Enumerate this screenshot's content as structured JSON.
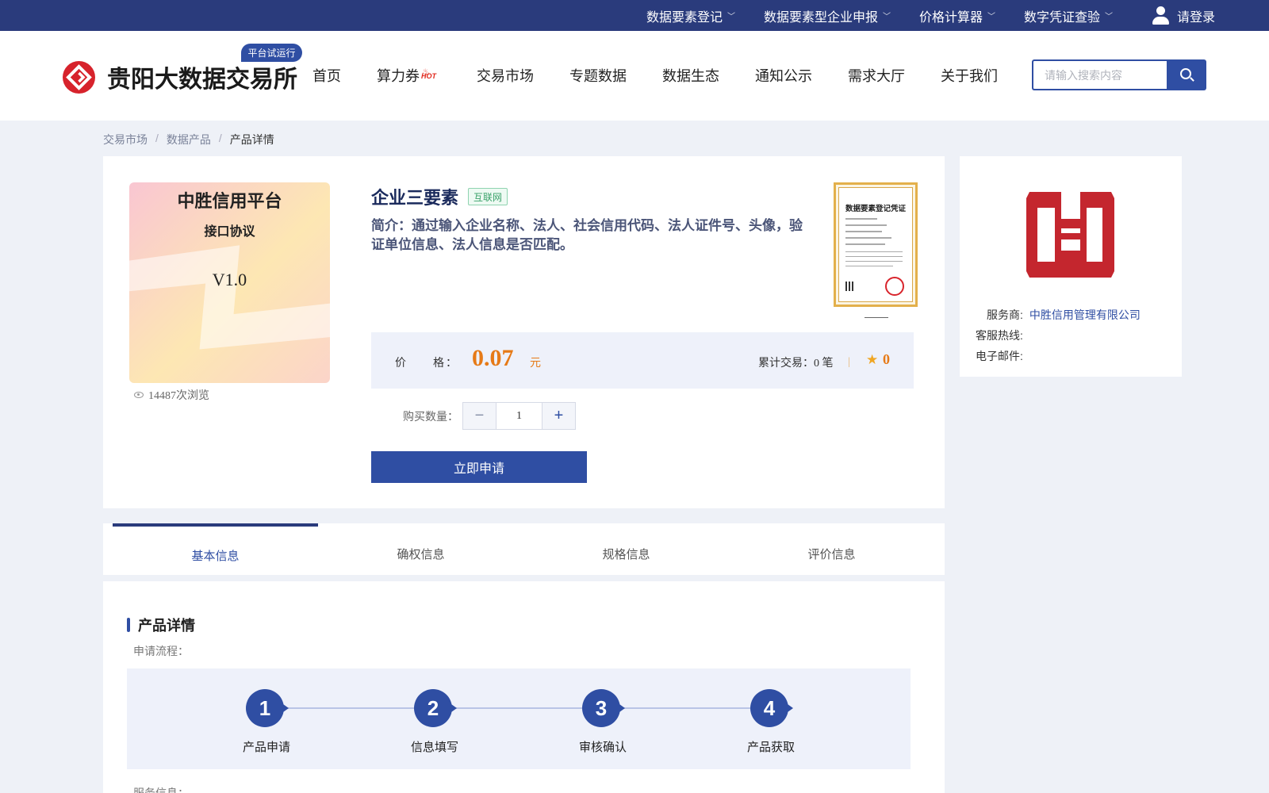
{
  "topbar": {
    "menus": [
      {
        "label": "数据要素登记"
      },
      {
        "label": "数据要素型企业申报"
      },
      {
        "label": "价格计算器"
      },
      {
        "label": "数字凭证查验"
      }
    ],
    "login_label": "请登录"
  },
  "header": {
    "logo_text": "贵阳大数据交易所",
    "trial_badge": "平台试运行",
    "nav": [
      "首页",
      "算力券",
      "交易市场",
      "专题数据",
      "数据生态",
      "通知公示",
      "需求大厅",
      "关于我们"
    ],
    "hot_label": "HOT",
    "search_placeholder": "请输入搜索内容"
  },
  "breadcrumb": {
    "items": [
      "交易市场",
      "数据产品"
    ],
    "current": "产品详情"
  },
  "product": {
    "image": {
      "title": "中胜信用平台",
      "subtitle": "接口协议",
      "version": "V1.0"
    },
    "views": "14487次浏览",
    "title": "企业三要素",
    "tag": "互联网",
    "description": "简介：通过输入企业名称、法人、社会信用代码、法人证件号、头像，验证单位信息、法人信息是否匹配。",
    "certificate_title": "数据要素登记凭证",
    "price_label": "价　　格：",
    "price_value": "0.07",
    "price_unit": "元",
    "trade_count": "累计交易：0 笔",
    "divider": "|",
    "rating": "0",
    "quantity_label": "购买数量：",
    "quantity": "1",
    "minus": "−",
    "plus": "+",
    "apply_label": "立即申请"
  },
  "vendor": {
    "provider_label": "服务商:",
    "provider_name": "中胜信用管理有限公司",
    "hotline_label": "客服热线:",
    "email_label": "电子邮件:",
    "brand_color": "#c4262e"
  },
  "tabs": [
    "基本信息",
    "确权信息",
    "规格信息",
    "评价信息"
  ],
  "details": {
    "section_title": "产品详情",
    "flow_label": "申请流程：",
    "steps": [
      {
        "num": "1",
        "label": "产品申请"
      },
      {
        "num": "2",
        "label": "信息填写"
      },
      {
        "num": "3",
        "label": "审核确认"
      },
      {
        "num": "4",
        "label": "产品获取"
      }
    ],
    "service_label": "服务信息："
  },
  "colors": {
    "topbar": "#2a3b7c",
    "primary": "#2f4ea3",
    "price": "#e67a17",
    "logo_red": "#d7232c"
  }
}
